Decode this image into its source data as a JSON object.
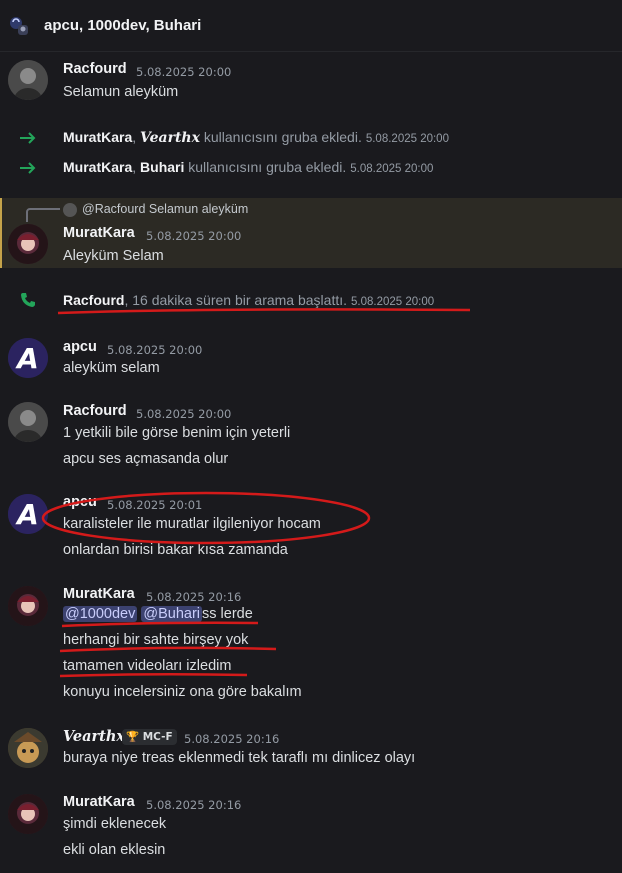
{
  "header": {
    "title": "apcu, 1000dev, Buhari"
  },
  "messages": {
    "m1": {
      "author": "Racfourd",
      "timestamp": "5.08.2025 20:00",
      "text": "Selamun aleyküm"
    },
    "sys1": {
      "name1": "MuratKara",
      "sep": ", ",
      "name2": "Vearthx",
      "action": " kullanıcısını gruba ekledi.",
      "timestamp": "5.08.2025 20:00"
    },
    "sys2": {
      "name1": "MuratKara",
      "sep": ", ",
      "name2": "Buhari",
      "action": " kullanıcısını gruba ekledi.",
      "timestamp": "5.08.2025 20:00"
    },
    "reply": {
      "reply_to": "@Racfourd Selamun aleyküm",
      "author": "MuratKara",
      "timestamp": "5.08.2025 20:00",
      "text": "Aleyküm Selam"
    },
    "call": {
      "name": "Racfourd",
      "action": ", 16 dakika süren bir arama başlattı.",
      "timestamp": "5.08.2025 20:00"
    },
    "m3": {
      "author": "apcu",
      "timestamp": "5.08.2025 20:00",
      "text": "aleyküm selam"
    },
    "m4": {
      "author": "Racfourd",
      "timestamp": "5.08.2025 20:00",
      "line1": "1 yetkili bile görse benim için yeterli",
      "line2": "apcu ses açmasanda olur"
    },
    "m5": {
      "author": "apcu",
      "timestamp": "5.08.2025 20:01",
      "line1": "karalisteler ile muratlar ilgileniyor hocam",
      "line2": "onlardan birisi bakar kısa zamanda"
    },
    "m6": {
      "author": "MuratKara",
      "timestamp": "5.08.2025 20:16",
      "mention1": "@1000dev",
      "mention2": "@Buhari",
      "line1_rest": "ss lerde",
      "line2": "herhangi bir sahte birşey yok",
      "line3": "tamamen videoları izledim",
      "line4": "konuyu incelersiniz ona göre bakalım"
    },
    "m7": {
      "author": "Vearthx",
      "badge": "MC-F",
      "timestamp": "5.08.2025 20:16",
      "text": "buraya niye treas eklenmedi tek taraflı mı dinlicez olayı"
    },
    "m8": {
      "author": "MuratKara",
      "timestamp": "5.08.2025 20:16",
      "line1": "şimdi eklenecek",
      "line2": "ekli olan eklesin"
    }
  },
  "colors": {
    "background": "#1a1a1e",
    "text": "#dbdee1",
    "muted": "#949ba4",
    "mention_bg": "#3c4270",
    "highlight": "#2c2a24",
    "arrow": "#23a55a",
    "annotation_red": "#d41a1a"
  },
  "icons": {
    "group": "group-avatar-icon",
    "join_arrow": "arrow-right-icon",
    "call": "phone-icon",
    "badge": "trophy-icon"
  }
}
